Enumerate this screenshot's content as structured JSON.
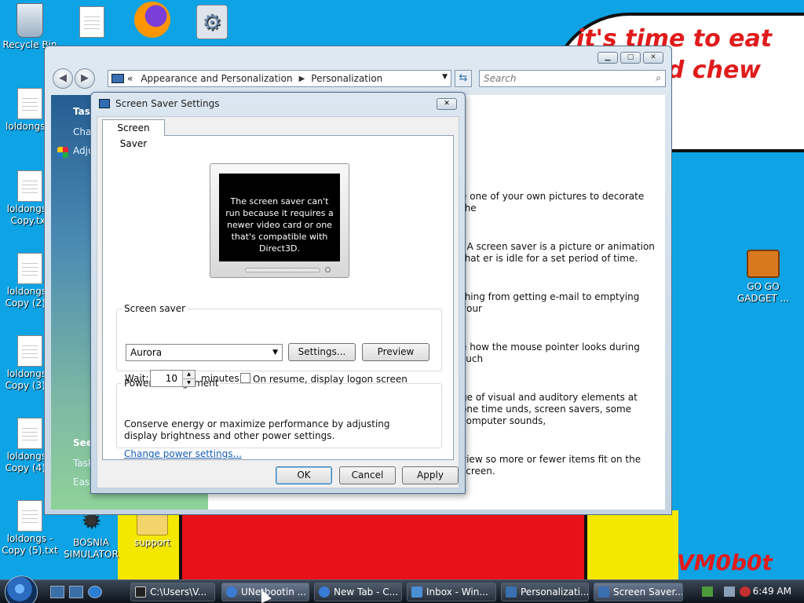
{
  "desktop": {
    "cloud_text": "it's time to eat shit and chew gum",
    "signature": "VM0b0t",
    "icons": [
      {
        "label": "Recycle Bin",
        "kind": "recycle"
      },
      {
        "label": "",
        "kind": "doc"
      },
      {
        "label": "",
        "kind": "firefox"
      },
      {
        "label": "",
        "kind": "gear"
      },
      {
        "label": "loldongs...",
        "kind": "doc"
      },
      {
        "label": "loldongs - Copy.txt",
        "kind": "doc"
      },
      {
        "label": "loldongs - Copy (2)...",
        "kind": "doc"
      },
      {
        "label": "loldongs - Copy (3)...",
        "kind": "doc"
      },
      {
        "label": "loldongs - Copy (4)...",
        "kind": "doc"
      },
      {
        "label": "loldongs - Copy (5).txt",
        "kind": "doc"
      },
      {
        "label": "BOSNIA SIMULATOR",
        "kind": "star"
      },
      {
        "label": "support",
        "kind": "folder"
      },
      {
        "label": "GO GO GADGET ...",
        "kind": "briefcase"
      }
    ]
  },
  "control_panel": {
    "breadcrumb": [
      "Appearance and Personalization",
      "Personalization"
    ],
    "breadcrumb_prefix": "«",
    "search_placeholder": "Search",
    "left_pane": {
      "tasks_label": "Task",
      "tasks": [
        "Chan",
        "Adju"
      ],
      "see_also_label": "See",
      "see_also": [
        "Task",
        "Ease"
      ]
    },
    "main_text": [
      "e one of your own pictures to decorate the",
      ". A screen saver is a picture or animation that er is idle for a set period of time.",
      "thing from getting e-mail to emptying your",
      "e how the mouse pointer looks during such",
      "ge of visual and auditory elements at one time unds, screen savers, some computer sounds,",
      "view so more or fewer items fit on the screen."
    ]
  },
  "dialog": {
    "title": "Screen Saver Settings",
    "tab": "Screen Saver",
    "preview_message": "The screen saver can't run because it requires a newer video card or one that's compatible with Direct3D.",
    "screen_saver_group": "Screen saver",
    "selected_saver": "Aurora",
    "settings_button": "Settings...",
    "preview_button": "Preview",
    "wait_label": "Wait:",
    "wait_value": "10",
    "minutes_label": "minutes",
    "logon_label": "On resume, display logon screen",
    "logon_checked": false,
    "power_group": "Power management",
    "power_text": "Conserve energy or maximize performance by adjusting display brightness and other power settings.",
    "power_link": "Change power settings...",
    "ok": "OK",
    "cancel": "Cancel",
    "apply": "Apply"
  },
  "taskbar": {
    "tasks": [
      {
        "label": "C:\\Users\\V...",
        "color": "#222222"
      },
      {
        "label": "UNetbootin ...",
        "color": "#3a7bd5"
      },
      {
        "label": "New Tab - C...",
        "color": "#3a7bd5"
      },
      {
        "label": "Inbox - Win...",
        "color": "#4a8fd6"
      },
      {
        "label": "Personalizati...",
        "color": "#3a6fb0"
      },
      {
        "label": "Screen Saver...",
        "color": "#3a6fb0"
      }
    ],
    "clock": "6:49 AM"
  },
  "colors": {
    "wallpaper": "#0da3e4",
    "cloud_text": "#e01b1b",
    "link": "#1a5fb4"
  }
}
